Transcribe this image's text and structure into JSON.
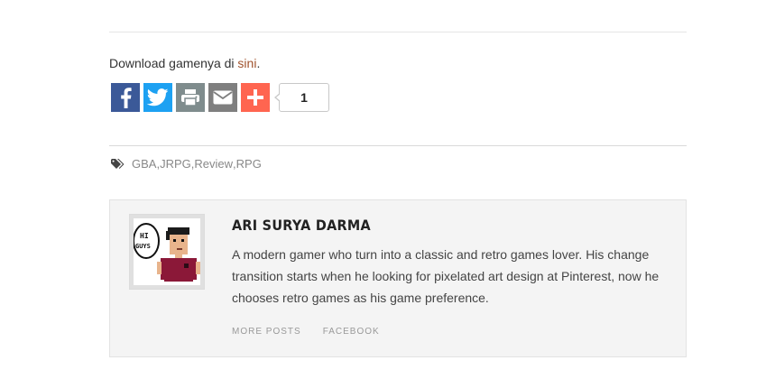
{
  "post": {
    "download_text": "Download gamenya di ",
    "download_link": "sini",
    "download_suffix": "."
  },
  "share": {
    "buttons": [
      {
        "name": "facebook",
        "icon": "facebook-icon",
        "color": "#3b5998"
      },
      {
        "name": "twitter",
        "icon": "twitter-icon",
        "color": "#1da1f2"
      },
      {
        "name": "print",
        "icon": "print-icon",
        "color": "#7f8c8d"
      },
      {
        "name": "email",
        "icon": "email-icon",
        "color": "#7f7f7f"
      },
      {
        "name": "more",
        "icon": "plus-icon",
        "color": "#ff6550"
      }
    ],
    "count": "1"
  },
  "tags": {
    "icon": "tags-icon",
    "items": [
      "GBA",
      "JRPG",
      "Review",
      "RPG"
    ],
    "separator": ", "
  },
  "author": {
    "name": "ARI SURYA DARMA",
    "bio": "A modern gamer who turn into a classic and retro games lover. His change transition starts when he looking for pixelated art design at Pinterest, now he chooses retro games as his game preference.",
    "avatar_text": "HI GUYS",
    "links": {
      "more_posts": "MORE POSTS",
      "facebook": "FACEBOOK"
    }
  }
}
